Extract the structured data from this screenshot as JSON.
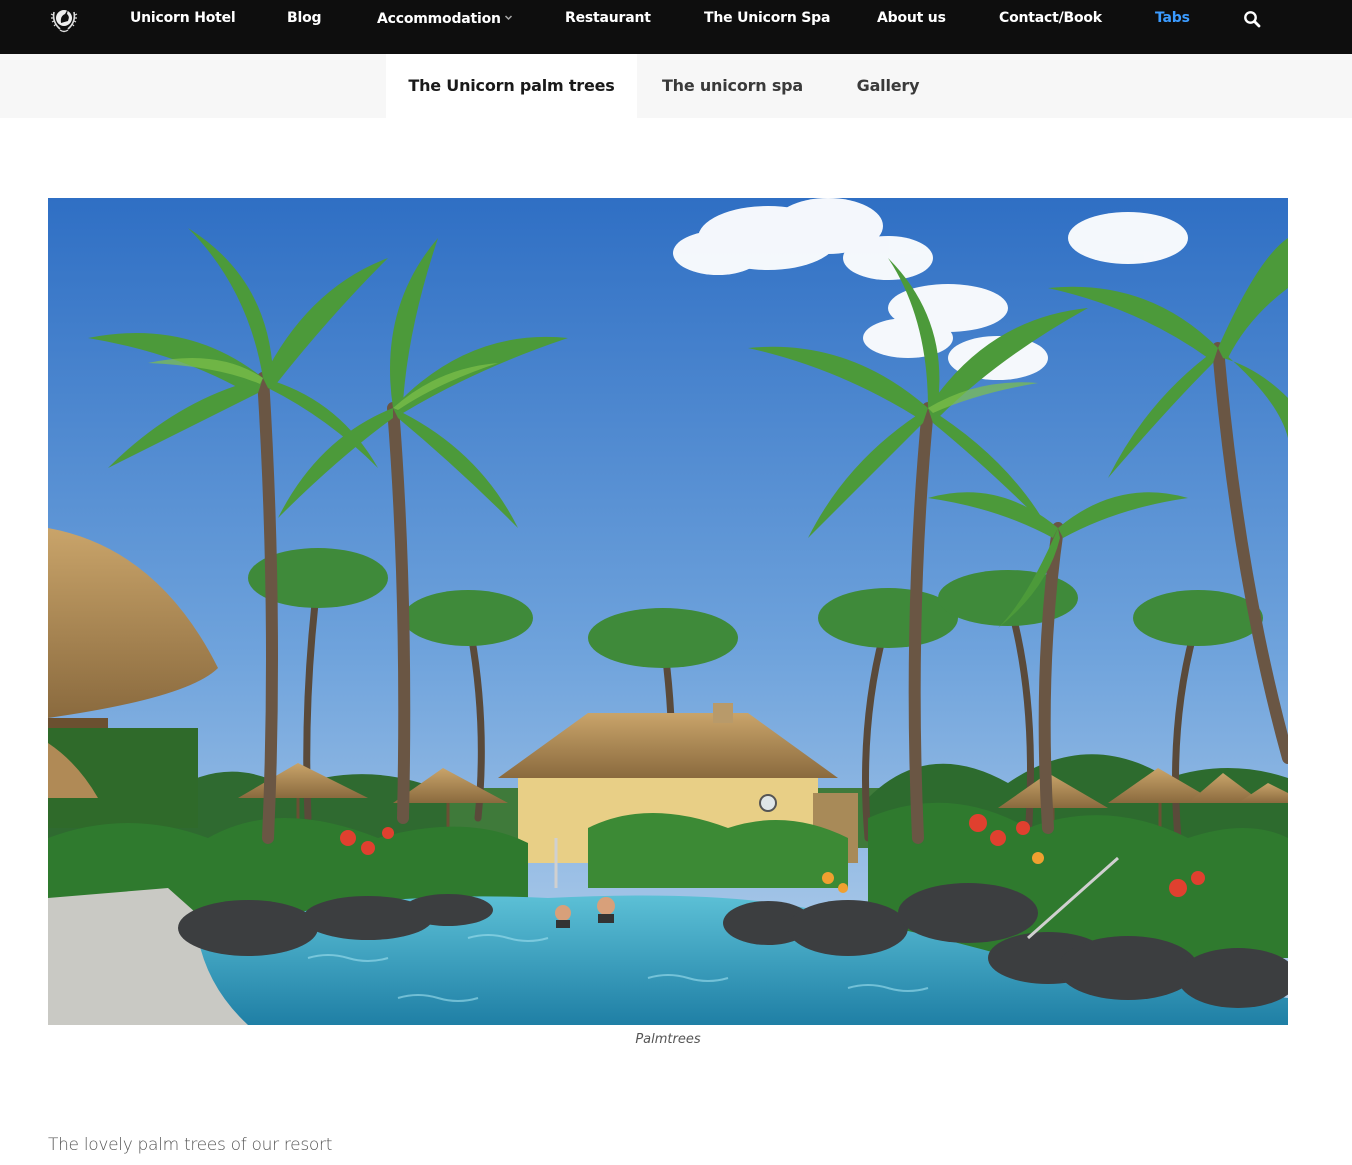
{
  "nav": {
    "logo_icon": "unicorn-crest-icon",
    "items": [
      {
        "label": "Unicorn Hotel"
      },
      {
        "label": "Blog"
      },
      {
        "label": "Accommodation"
      },
      {
        "label": "Restaurant"
      },
      {
        "label": "The Unicorn Spa"
      },
      {
        "label": "About us"
      },
      {
        "label": "Contact/Book"
      },
      {
        "label": "Tabs"
      }
    ],
    "active_item": "Tabs",
    "accent_color": "#3b9bff",
    "background_color": "#0e0e0e",
    "search_icon": "search-icon"
  },
  "tabs": {
    "items": [
      {
        "label": "The Unicorn palm trees"
      },
      {
        "label": "The unicorn spa"
      },
      {
        "label": "Gallery"
      }
    ],
    "active_tab": "The Unicorn palm trees"
  },
  "content": {
    "image_caption": "Palmtrees",
    "text": "The lovely palm trees of our resort"
  }
}
